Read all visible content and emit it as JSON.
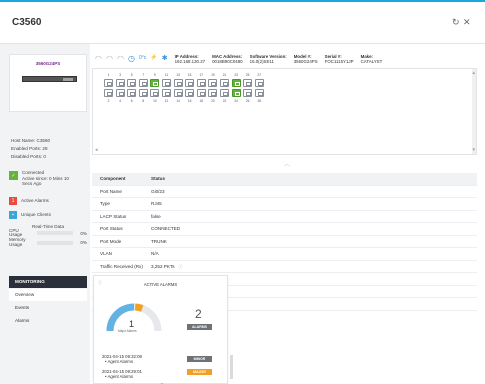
{
  "window": {
    "title": "C3560",
    "refresh_icon": "refresh-icon",
    "close_icon": "close-icon"
  },
  "device": {
    "model_label": "3560G24PS",
    "host_name_label": "Host Name: C3560",
    "enabled_ports_label": "Enabled Ports: 28",
    "disabled_ports_label": "Disabled Ports: 0"
  },
  "status": {
    "connected_line1": "Connected",
    "connected_line2": "Active since: 0 Mins 10",
    "connected_line3": "Secs Ago",
    "active_alarms": "Active Alarms",
    "active_alarms_count": "1",
    "unique_clients": "Unique Clients"
  },
  "realtime": {
    "title": "Real-Time Data",
    "cpu_label": "CPU Usage",
    "cpu_value": "0%",
    "memory_label_1": "Memory",
    "memory_label_2": "Usage",
    "memory_value": "0%",
    "cpu_percent": 0,
    "memory_percent": 0
  },
  "nav": {
    "header": "MONITORING",
    "items": [
      "Overview",
      "Events",
      "Alarms"
    ]
  },
  "header_info": {
    "temp": "0°c",
    "ip_label": "IP Address:",
    "ip_value": "192.168.130.27",
    "mac_label": "MAC Address:",
    "mac_value": "0018B90C0480",
    "sw_label": "Software Version:",
    "sw_value": "15.0(2)SE11",
    "model_label": "Model #:",
    "model_value": "3560G24PS",
    "serial_label": "Serial #:",
    "serial_value": "FOC1115Y1JP",
    "make_label": "Make:",
    "make_value": "CATALYST"
  },
  "ports": {
    "top_numbers": [
      "1",
      "3",
      "5",
      "7",
      "9",
      "11",
      "13",
      "15",
      "17",
      "19",
      "21",
      "23",
      "25",
      "27"
    ],
    "bottom_numbers": [
      "2",
      "4",
      "6",
      "8",
      "10",
      "12",
      "14",
      "16",
      "18",
      "20",
      "22",
      "24",
      "26",
      "28"
    ],
    "top_up": [
      false,
      false,
      false,
      false,
      true,
      false,
      false,
      false,
      false,
      false,
      false,
      true,
      false,
      false
    ],
    "bottom_up": [
      false,
      false,
      false,
      false,
      false,
      false,
      false,
      false,
      false,
      false,
      false,
      true,
      false,
      false
    ]
  },
  "details": {
    "header": [
      "Component",
      "Status"
    ],
    "rows": [
      [
        "Port Name",
        "Gi0/23"
      ],
      [
        "Type",
        "RJ45"
      ],
      [
        "LACP Status",
        "false"
      ],
      [
        "Port Status",
        "CONNECTED"
      ],
      [
        "Port Mode",
        "TRUNK"
      ],
      [
        "VLAN",
        "N/A"
      ],
      [
        "Traffic Received (Rx)",
        "3,252 PKTs"
      ],
      [
        "Traffic Transmitted (Tx)",
        "190 PKTs"
      ],
      [
        "Power Used",
        "0 mW"
      ],
      [
        "Port Speed",
        "1000 Mbps"
      ]
    ]
  },
  "alarms_panel": {
    "title": "ACTIVE ALARMS",
    "gauge_value": "1",
    "gauge_label": "Major Alarms",
    "gauge_fraction": 0.5,
    "total": "2",
    "total_badge": "ALARMS",
    "list": [
      {
        "time": "2021-04-15 09:32:08",
        "source": "• Agent Alarms",
        "severity": "MINOR",
        "color": "#6e7176"
      },
      {
        "time": "2021-04-15 09:29:01",
        "source": "• Agent Alarms",
        "severity": "MAJOR",
        "color": "#f2a024"
      }
    ]
  },
  "colors": {
    "accent": "#1aa7dc",
    "port_up": "#62b53b",
    "alarm_red": "#e94b3c",
    "clients_blue": "#3aa6d8",
    "nav_dark": "#2b2f3a",
    "gauge_blue": "#62b3e4",
    "gauge_orange": "#f2a024"
  }
}
